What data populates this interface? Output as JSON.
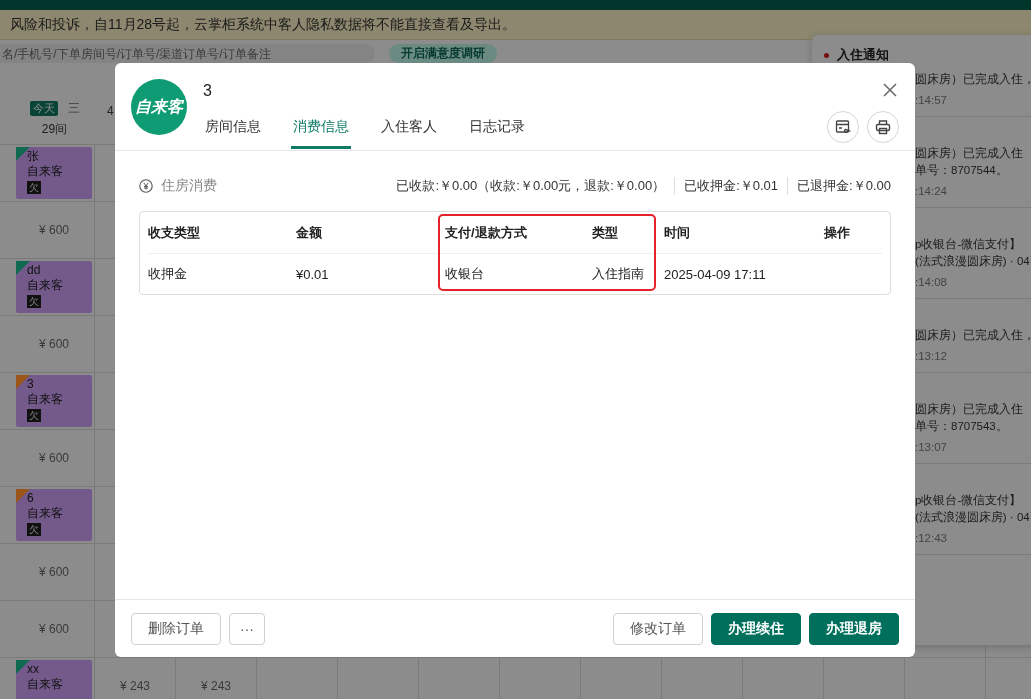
{
  "notice": "风险和投诉，自11月28号起，云掌柜系统中客人隐私数据将不能直接查看及导出。",
  "search": {
    "placeholder": "名/手机号/下单房间号/订单号/渠道订单号/订单备注"
  },
  "survey_button": "开启满意度调研",
  "date_header": {
    "today_badge": "今天",
    "weekday": "三",
    "rooms": "29间",
    "next_day": "4"
  },
  "grid_rows": [
    {
      "kind": "booking",
      "name": "张",
      "source": "自来客",
      "badge": "欠",
      "color": "#106a52"
    },
    {
      "kind": "price",
      "price": "¥ 600"
    },
    {
      "kind": "booking",
      "name": "dd",
      "source": "自来客",
      "badge": "欠",
      "color": "#106a52"
    },
    {
      "kind": "price",
      "price": "¥ 600"
    },
    {
      "kind": "booking",
      "name": "3",
      "source": "自来客",
      "badge": "欠",
      "color": "#9a5518"
    },
    {
      "kind": "price",
      "price": "¥ 600"
    },
    {
      "kind": "booking",
      "name": "6",
      "source": "自来客",
      "badge": "欠",
      "color": "#9a5518"
    },
    {
      "kind": "price",
      "price": "¥ 600"
    },
    {
      "kind": "price",
      "price": "¥ 600"
    },
    {
      "kind": "booking",
      "name": "xx",
      "source": "自来客",
      "color": "#106a52",
      "extra_prices": [
        "¥ 243",
        "¥ 243"
      ]
    }
  ],
  "notifications": {
    "title": "入住通知",
    "items": [
      {
        "lines": [
          "圆床房）已完成入住，"
        ],
        "time": ":14:57"
      },
      {
        "lines": [
          "圆床房）已完成入住",
          "单号：8707544。"
        ],
        "time": ":14:24"
      },
      {
        "lines": [
          "p收银台-微信支付】",
          "(法式浪漫圆床房) · 04"
        ],
        "time": ":14:08"
      },
      {
        "lines": [
          "圆床房）已完成入住，"
        ],
        "time": ":13:12"
      },
      {
        "lines": [
          "圆床房）已完成入住",
          "单号：8707543。"
        ],
        "time": ":13:07"
      },
      {
        "lines": [
          "p收银台-微信支付】",
          "(法式浪漫圆床房) · 04"
        ],
        "time": ":12:43"
      }
    ]
  },
  "modal": {
    "avatar_text": "自来客",
    "title": "3",
    "tabs": [
      {
        "label": "房间信息",
        "selected": false
      },
      {
        "label": "消费信息",
        "selected": true
      },
      {
        "label": "入住客人",
        "selected": false
      },
      {
        "label": "日志记录",
        "selected": false
      }
    ],
    "section_title": "住房消费",
    "summary": [
      "已收款:￥0.00（收款:￥0.00元，退款:￥0.00）",
      "已收押金:￥0.01",
      "已退押金:￥0.00"
    ],
    "table": {
      "columns": [
        "收支类型",
        "金额",
        "支付/退款方式",
        "类型",
        "时间",
        "操作"
      ],
      "rows": [
        [
          "收押金",
          "¥0.01",
          "收银台",
          "入住指南",
          "2025-04-09 17:11",
          ""
        ]
      ]
    },
    "footer_left": [
      "删除订单",
      "···"
    ],
    "footer_right": [
      {
        "label": "修改订单",
        "kind": "secondary"
      },
      {
        "label": "办理续住",
        "kind": "primary"
      },
      {
        "label": "办理退房",
        "kind": "primary"
      }
    ]
  }
}
